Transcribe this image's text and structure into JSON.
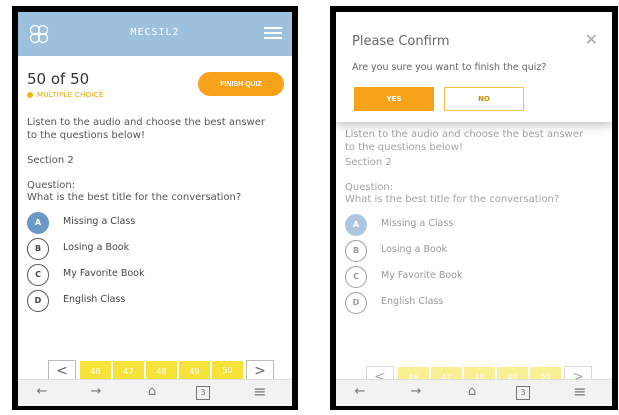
{
  "app": {
    "title": "MECSIL2",
    "counter": "50 of 50",
    "question_type": "MULTIPLE CHOICE",
    "finish_label": "FINISH QUIZ"
  },
  "content": {
    "instruction": "Listen to the audio and choose the best answer to the questions below!",
    "section": "Section 2",
    "question_label": "Question:",
    "question_text": "What is the best title for the conversation?",
    "options": [
      {
        "letter": "A",
        "text": "Missing a Class",
        "selected": true
      },
      {
        "letter": "B",
        "text": "Losing a Book",
        "selected": false
      },
      {
        "letter": "C",
        "text": "My Favorite Book",
        "selected": false
      },
      {
        "letter": "D",
        "text": "English Class",
        "selected": false
      }
    ]
  },
  "pager": {
    "prev": "<",
    "next": ">",
    "pages": [
      "46",
      "47",
      "48",
      "49",
      "50"
    ],
    "current": "50"
  },
  "modal": {
    "title": "Please Confirm",
    "close": "✕",
    "question": "Are you sure you want to finish the quiz?",
    "yes": "YES",
    "no": "NO"
  },
  "bottom_nav": {
    "back": "←",
    "forward": "→",
    "home": "⌂",
    "tabs": "3",
    "menu": "≡"
  },
  "colors": {
    "topbar": "#9dc1dc",
    "accent": "#f7a21b",
    "selected_option": "#6b99c6",
    "pager": "#f7e23a"
  }
}
